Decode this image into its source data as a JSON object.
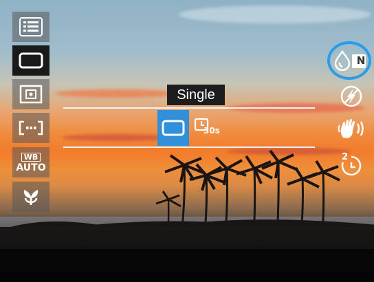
{
  "menu": {
    "selected_label": "Single"
  },
  "left_toolbar": {
    "items": [
      {
        "icon": "menu-list-icon"
      },
      {
        "icon": "single-frame-icon",
        "active": true
      },
      {
        "icon": "metering-icon"
      },
      {
        "icon": "focus-area-icon"
      },
      {
        "icon": "white-balance-icon",
        "line1": "WB",
        "line2": "AUTO"
      },
      {
        "icon": "macro-flower-icon"
      }
    ]
  },
  "right_toolbar": {
    "items": [
      {
        "icon": "color-mode-icon",
        "badge": "N"
      },
      {
        "icon": "flash-off-icon"
      },
      {
        "icon": "stabilizer-icon"
      },
      {
        "icon": "self-timer-icon",
        "value": "2"
      }
    ]
  },
  "drive_options": [
    {
      "icon": "single-frame-icon",
      "selected": true
    },
    {
      "icon": "interval-timer-icon",
      "value": "30s"
    }
  ],
  "colors": {
    "accent": "#2f8fd8",
    "focus_ring": "#2a9ce8"
  }
}
